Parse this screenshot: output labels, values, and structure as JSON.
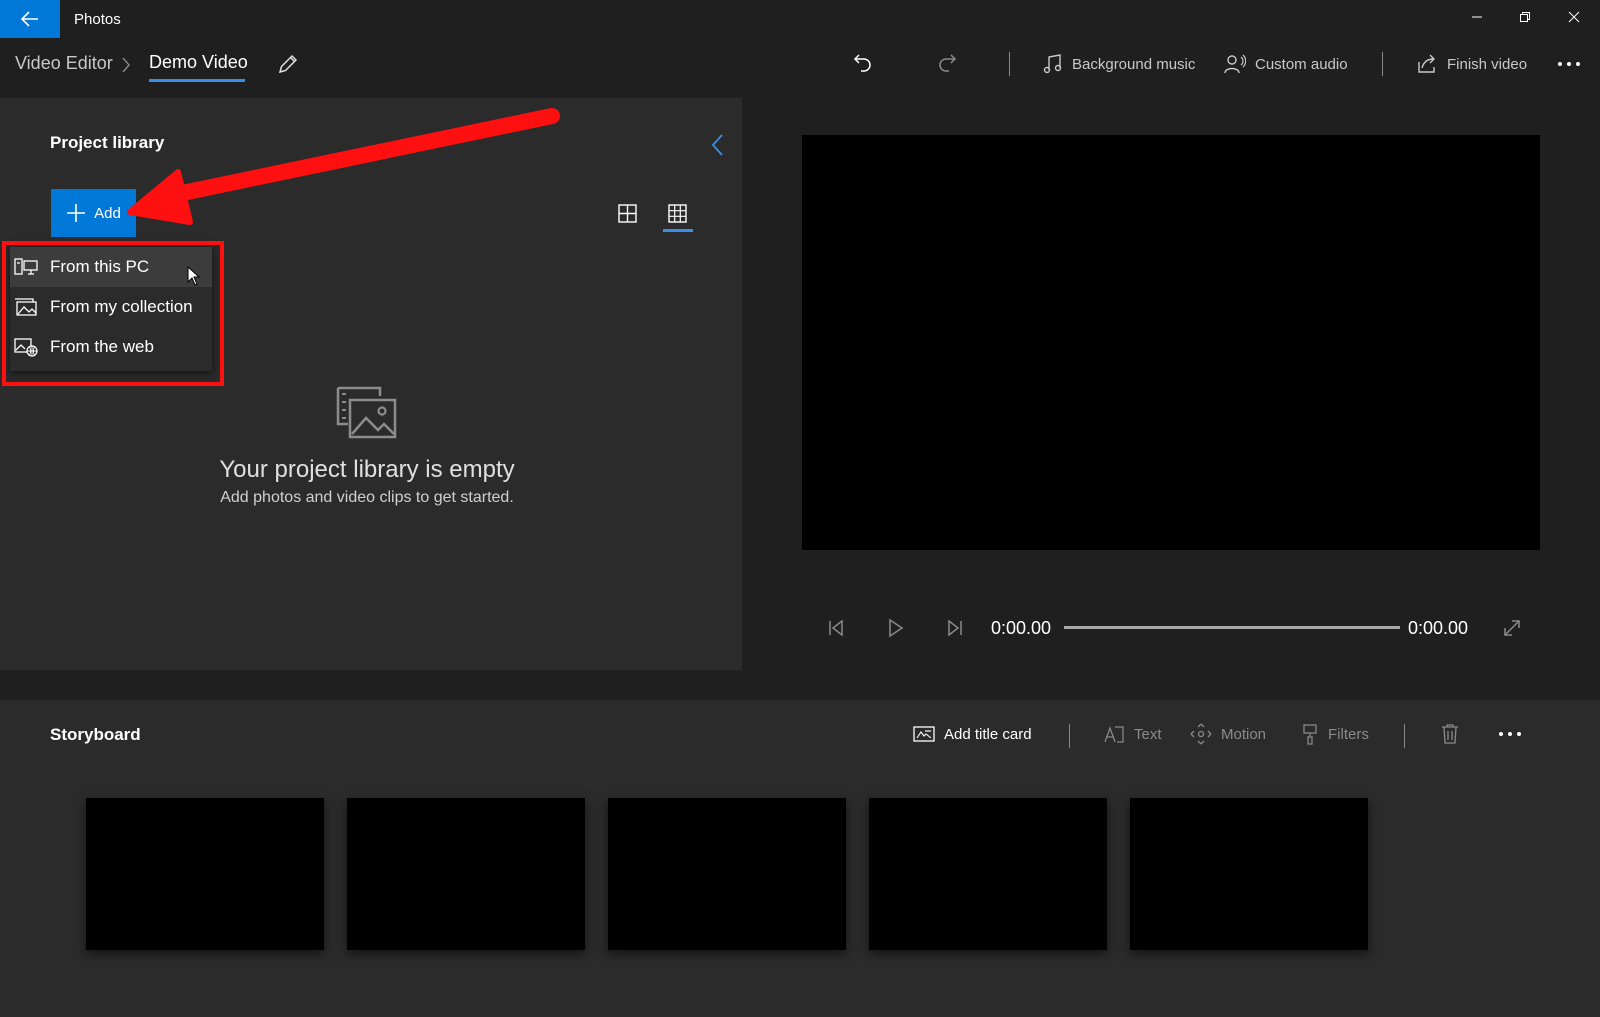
{
  "app": {
    "title": "Photos"
  },
  "breadcrumb": {
    "parent": "Video Editor",
    "current": "Demo Video"
  },
  "toolbar": {
    "background_music": "Background music",
    "custom_audio": "Custom audio",
    "finish_video": "Finish video"
  },
  "library": {
    "title": "Project library",
    "add_label": "Add",
    "empty_title": "Your project library is empty",
    "empty_subtitle": "Add photos and video clips to get started.",
    "menu": [
      {
        "label": "From this PC",
        "icon": "pc-icon"
      },
      {
        "label": "From my collection",
        "icon": "collection-icon"
      },
      {
        "label": "From the web",
        "icon": "web-icon"
      }
    ]
  },
  "player": {
    "time_current": "0:00.00",
    "time_total": "0:00.00"
  },
  "storyboard": {
    "title": "Storyboard",
    "add_title_card": "Add title card",
    "text": "Text",
    "motion": "Motion",
    "filters": "Filters",
    "clips": 5
  },
  "colors": {
    "accent": "#0078d7",
    "highlight": "#ff1010",
    "panel": "#2b2b2b",
    "background": "#1f1f1f"
  }
}
